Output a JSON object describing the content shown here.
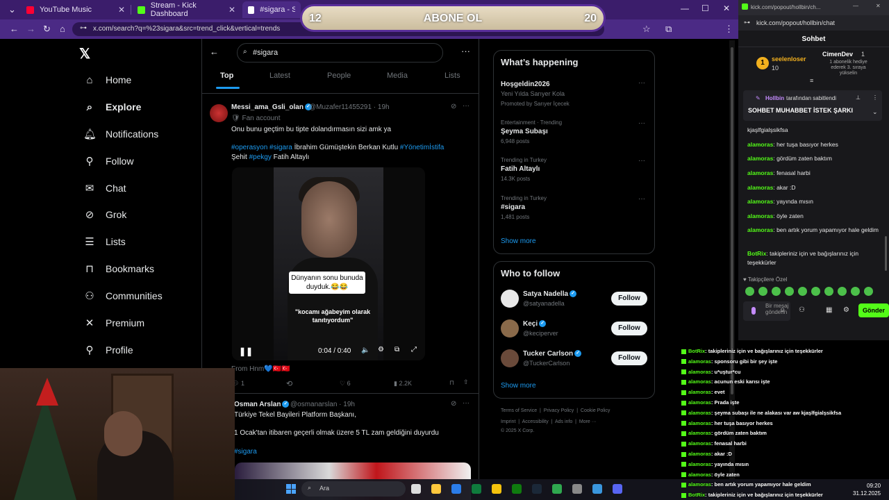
{
  "browser": {
    "tabs": [
      {
        "label": "YouTube Music"
      },
      {
        "label": "Stream - Kick Dashboard"
      },
      {
        "label": "#sigara - Search / X"
      }
    ],
    "url": "x.com/search?q=%23sigara&src=trend_click&vertical=trends"
  },
  "banner": {
    "left_num": "12",
    "text": "ABONE OL",
    "right_num": "20"
  },
  "xnav": {
    "items": [
      {
        "label": "Home",
        "icon": "home-icon"
      },
      {
        "label": "Explore",
        "icon": "search-icon"
      },
      {
        "label": "Notifications",
        "icon": "bell-icon"
      },
      {
        "label": "Follow",
        "icon": "person-add-icon"
      },
      {
        "label": "Chat",
        "icon": "mail-icon"
      },
      {
        "label": "Grok",
        "icon": "grok-icon"
      },
      {
        "label": "Lists",
        "icon": "list-icon"
      },
      {
        "label": "Bookmarks",
        "icon": "bookmark-icon"
      },
      {
        "label": "Communities",
        "icon": "people-icon"
      },
      {
        "label": "Premium",
        "icon": "x-icon"
      },
      {
        "label": "Profile",
        "icon": "person-icon"
      }
    ]
  },
  "search": {
    "query": "#sigara",
    "tabs": [
      "Top",
      "Latest",
      "People",
      "Media",
      "Lists"
    ]
  },
  "tweet1": {
    "name": "Messi_ama_Gsli_olan",
    "handle": "@Muzafer11455291 · 19h",
    "badge": "Fan account",
    "text1": "Onu bunu geçtim bu tipte dolandırmasın sizi amk ya",
    "hashtags": "#operasyon #sigara",
    "names": "İbrahim Gümüştekin Berkan Kutlu",
    "hashtag3": "#Yönetimİstifa",
    "line2_prefix": "Şehit",
    "hashtag4": "#pekgy",
    "line2_suffix": "Fatih Altaylı",
    "caption1": "Dünyanın sonu bunuda duyduk.😂😂",
    "caption2": "\"kocamı ağabeyim olarak tanıtıyordum\"",
    "time": "0:04 / 0:40",
    "from": "From Hnm💙🇹🇷🇹🇷",
    "replies": "1",
    "likes": "6",
    "views": "2.2K"
  },
  "tweet2": {
    "name": "Osman Arslan",
    "handle": "@osmanarslan · 19h",
    "text1": "Türkiye Tekel Bayileri Platform Başkanı,",
    "text2": "1 Ocak'tan itibaren geçerli olmak üzere 5 TL zam geldiğini duyurdu",
    "hashtag": "#sigara"
  },
  "happening": {
    "title": "What’s happening",
    "trends": [
      {
        "meta": "",
        "name": "Hoşgeldin2026",
        "sub": "Yeni Yılda Sarıyer Kola",
        "count": "Promoted by Sarıyer İçecek"
      },
      {
        "meta": "Entertainment · Trending",
        "name": "Şeyma Subaşı",
        "sub": "",
        "count": "6,948 posts"
      },
      {
        "meta": "Trending in Turkey",
        "name": "Fatih Altaylı",
        "sub": "",
        "count": "14.3K posts"
      },
      {
        "meta": "Trending in Turkey",
        "name": "#sigara",
        "sub": "",
        "count": "1,481 posts"
      }
    ],
    "show_more": "Show more"
  },
  "who_to_follow": {
    "title": "Who to follow",
    "users": [
      {
        "name": "Satya Nadella",
        "handle": "@satyanadella",
        "button": "Follow"
      },
      {
        "name": "Keçi",
        "handle": "@keciperver",
        "button": "Follow"
      },
      {
        "name": "Tucker Carlson",
        "handle": "@TuckerCarlson",
        "button": "Follow"
      }
    ],
    "show_more": "Show more"
  },
  "footer": {
    "line1": [
      "Terms of Service",
      "Privacy Policy",
      "Cookie Policy"
    ],
    "line2": [
      "Imprint",
      "Accessibility",
      "Ads info",
      "More ···"
    ],
    "copyright": "© 2025 X Corp."
  },
  "kick": {
    "window_url": "kick.com/popout/hollbin/ch...",
    "url": "kick.com/popout/hollbin/chat",
    "header": "Sohbet",
    "gift_user": "seelenloser",
    "gift_count": "10",
    "gift_user2": "CimenDev",
    "gift_user2_count": "1",
    "gift_note": "1 abonelik hediye ederek 3. sıraya yükselin",
    "pinned_by": "Hollbin",
    "pinned_by_suffix": "tarafından sabitlendi",
    "pinned_text": "SOHBET MUHABBET İSTEK ŞARKI",
    "messages": [
      {
        "user": "",
        "text": "kjaşlfgialşsikfsa"
      },
      {
        "user": "alamoras",
        "text": ": her tuşa basıyor herkes"
      },
      {
        "user": "alamoras",
        "text": ": gördüm zaten baktım"
      },
      {
        "user": "alamoras",
        "text": ": fenasal harbi"
      },
      {
        "user": "alamoras",
        "text": ": akar :D"
      },
      {
        "user": "alamoras",
        "text": ": yayında mısın"
      },
      {
        "user": "alamoras",
        "text": ": öyle zaten"
      },
      {
        "user": "alamoras",
        "text": ": ben artık yorum yapamıyor hale geldim"
      },
      {
        "user": "BotRix",
        "text": ": takipleriniz için ve bağışlarınız için teşekkürler"
      }
    ],
    "followers_only": "Takipçilere Özel",
    "input_placeholder": "Bir mesaj gönderin",
    "send": "Gönder"
  },
  "overlay_chat": [
    {
      "user": "BotRix",
      "text": ": takipleriniz için ve bağışlarınız için teşekkürler"
    },
    {
      "user": "alamoras",
      "text": ": sponsoru gibi bir şey işte"
    },
    {
      "user": "alamoras",
      "text": ": u*uştur*cu"
    },
    {
      "user": "alamoras",
      "text": ": acunun eski karısı işte"
    },
    {
      "user": "alamoras",
      "text": ": evet"
    },
    {
      "user": "alamoras",
      "text": ": Prada işte"
    },
    {
      "user": "alamoras",
      "text": ": şeyma subaşı ile ne alakası var aw kjaşlfgialşsikfsa"
    },
    {
      "user": "alamoras",
      "text": ": her tuşa basıyor herkes"
    },
    {
      "user": "alamoras",
      "text": ": gördüm zaten baktım"
    },
    {
      "user": "alamoras",
      "text": ": fenasal harbi"
    },
    {
      "user": "alamoras",
      "text": ": akar :D"
    },
    {
      "user": "alamoras",
      "text": ": yayında mısın"
    },
    {
      "user": "alamoras",
      "text": ": öyle zaten"
    },
    {
      "user": "alamoras",
      "text": ": ben artık yorum yapamıyor hale geldim"
    },
    {
      "user": "BotRix",
      "text": ": takipleriniz için ve bağışlarınız için teşekkürler"
    }
  ],
  "taskbar": {
    "search": "Ara",
    "time": "09:20",
    "date": "31.12.2025"
  }
}
